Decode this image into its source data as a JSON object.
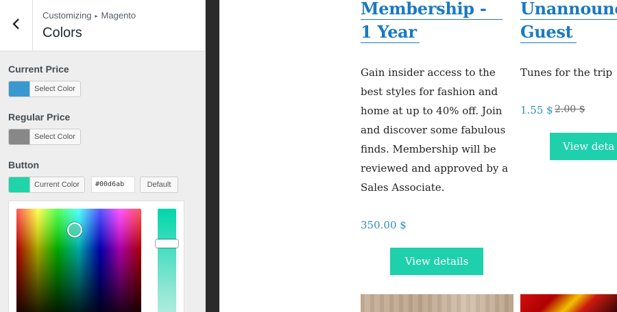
{
  "panel": {
    "breadcrumb_root": "Customizing",
    "breadcrumb_sep": "▸",
    "breadcrumb_section": "Magento",
    "title": "Colors",
    "controls": {
      "current_price": {
        "label": "Current Price",
        "button": "Select Color",
        "swatch": "#3a98d0"
      },
      "regular_price": {
        "label": "Regular Price",
        "button": "Select Color",
        "swatch": "#888888"
      },
      "button": {
        "label": "Button",
        "current": "Current Color",
        "swatch": "#1fd4a9",
        "hex_value": "#00d6ab",
        "default_label": "Default"
      }
    }
  },
  "preview": {
    "product1": {
      "title_line1": "Membership -",
      "title_line2": "1 Year",
      "description": "Gain insider access to the best styles for fashion and home at up to 40% off. Join and discover some fabulous finds. Membership will be reviewed and approved by a Sales Associate.",
      "price": "350.00 $",
      "cta": "View details"
    },
    "product2": {
      "title_line1": "Unannounc",
      "title_line2": "Guest",
      "description": "Tunes for the trip",
      "price": "1.55 $",
      "old_price": "2.00 $",
      "cta": "View deta"
    }
  },
  "colors": {
    "accent": "#1979c3",
    "cta": "#1fd0ad",
    "price": "#2e8ec6"
  }
}
